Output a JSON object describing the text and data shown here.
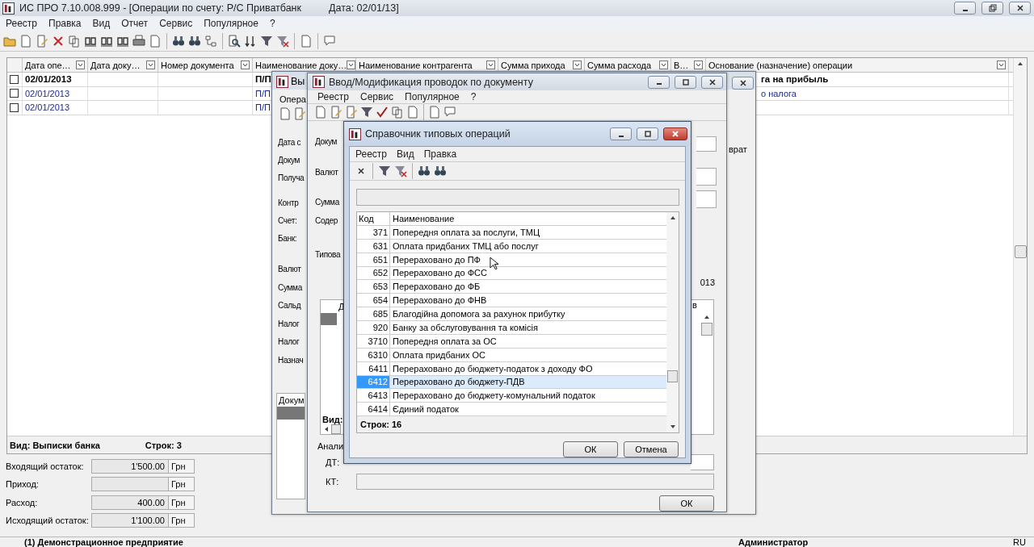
{
  "main_window": {
    "title": "ИС ПРО 7.10.008.999 - [Операции по счету: Р/С Приватбанк",
    "title_date": "Дата: 02/01/13]",
    "menu": [
      "Реестр",
      "Правка",
      "Вид",
      "Отчет",
      "Сервис",
      "Популярное",
      "?"
    ],
    "table": {
      "columns": [
        "Дата опе…",
        "Дата доку…",
        "Номер документа",
        "Наименование доку…",
        "Наименование контрагента",
        "Сумма прихода",
        "Сумма расхода",
        "В…",
        "Основание (назначение) операции"
      ],
      "rows": [
        {
          "kind": "group",
          "checked": false,
          "date": "02/01/2013",
          "doc_name": "П/П",
          "basis": "га на прибыль"
        },
        {
          "kind": "item",
          "checked": false,
          "date": "02/01/2013",
          "doc_name": "П/П",
          "basis": "о налога"
        },
        {
          "kind": "item",
          "checked": false,
          "date": "02/01/2013",
          "doc_name": "П/П"
        }
      ]
    },
    "footer": {
      "view": "Вид: Выписки банка",
      "row_count": "Строк: 3"
    },
    "balances": [
      {
        "label": "Входящий остаток:",
        "value": "1'500.00",
        "unit": "Грн"
      },
      {
        "label": "Приход:",
        "unit": "Грн"
      },
      {
        "label": "Расход:",
        "value": "400.00",
        "unit": "Грн"
      },
      {
        "label": "Исходящий остаток:",
        "value": "1'100.00",
        "unit": "Грн"
      }
    ],
    "status_bar": {
      "company": "(1) Демонстрационное предприятие",
      "user": "Администратор",
      "language": "RU"
    }
  },
  "statement_window": {
    "title": "Вы",
    "menu": [
      "Опера"
    ],
    "labels": [
      "Дата с",
      "Докум",
      "Получа",
      "Контр",
      "Счет:",
      "Банк:",
      "Валют",
      "Сумма",
      "Сальд",
      "Налог",
      "Налог",
      "Назнач"
    ],
    "grid_header": "Докум",
    "right_text": "врат"
  },
  "entry_window": {
    "title": "Ввод/Модификация проводок по документу",
    "menu": [
      "Реестр",
      "Сервис",
      "Популярное",
      "?"
    ],
    "labels": [
      "Докум",
      "Валют",
      "Сумма",
      "Содер",
      "Типова"
    ],
    "date_fragment": "013",
    "grid_columns": [
      "Д",
      "в"
    ],
    "view_label": "Вид:",
    "analytics_label": "Анали",
    "dt_label": "ДТ:",
    "kt_label": "КТ:",
    "ok_button": "ОК"
  },
  "operations_dialog": {
    "title": "Справочник типовых операций",
    "menu": [
      "Реестр",
      "Вид",
      "Правка"
    ],
    "columns": [
      "Код",
      "Наименование"
    ],
    "rows": [
      {
        "code": "371",
        "name": "Попередня оплата за послуги, ТМЦ",
        "selected": false
      },
      {
        "code": "631",
        "name": "Оплата придбаних ТМЦ або послуг",
        "selected": false
      },
      {
        "code": "651",
        "name": "Перераховано до ПФ",
        "selected": false
      },
      {
        "code": "652",
        "name": "Перераховано до ФСС",
        "selected": false
      },
      {
        "code": "653",
        "name": "Перераховано до ФБ",
        "selected": false
      },
      {
        "code": "654",
        "name": "Перераховано до ФНВ",
        "selected": false
      },
      {
        "code": "685",
        "name": "Благодійна допомога за рахунок прибутку",
        "selected": false
      },
      {
        "code": "920",
        "name": "Банку за обслуговування та комісія",
        "selected": false
      },
      {
        "code": "3710",
        "name": "Попередня оплата за ОС",
        "selected": false
      },
      {
        "code": "6310",
        "name": "Оплата придбаних ОС",
        "selected": false
      },
      {
        "code": "6411",
        "name": "Перераховано до бюджету-податок з доходу ФО",
        "selected": false
      },
      {
        "code": "6412",
        "name": "Перераховано до бюджету-ПДВ",
        "selected": true
      },
      {
        "code": "6413",
        "name": "Перераховано до бюджету-комунальний податок",
        "selected": false
      },
      {
        "code": "6414",
        "name": "Єдиний податок",
        "selected": false
      }
    ],
    "row_count": "Строк: 16",
    "buttons": [
      "ОК",
      "Отмена"
    ]
  }
}
